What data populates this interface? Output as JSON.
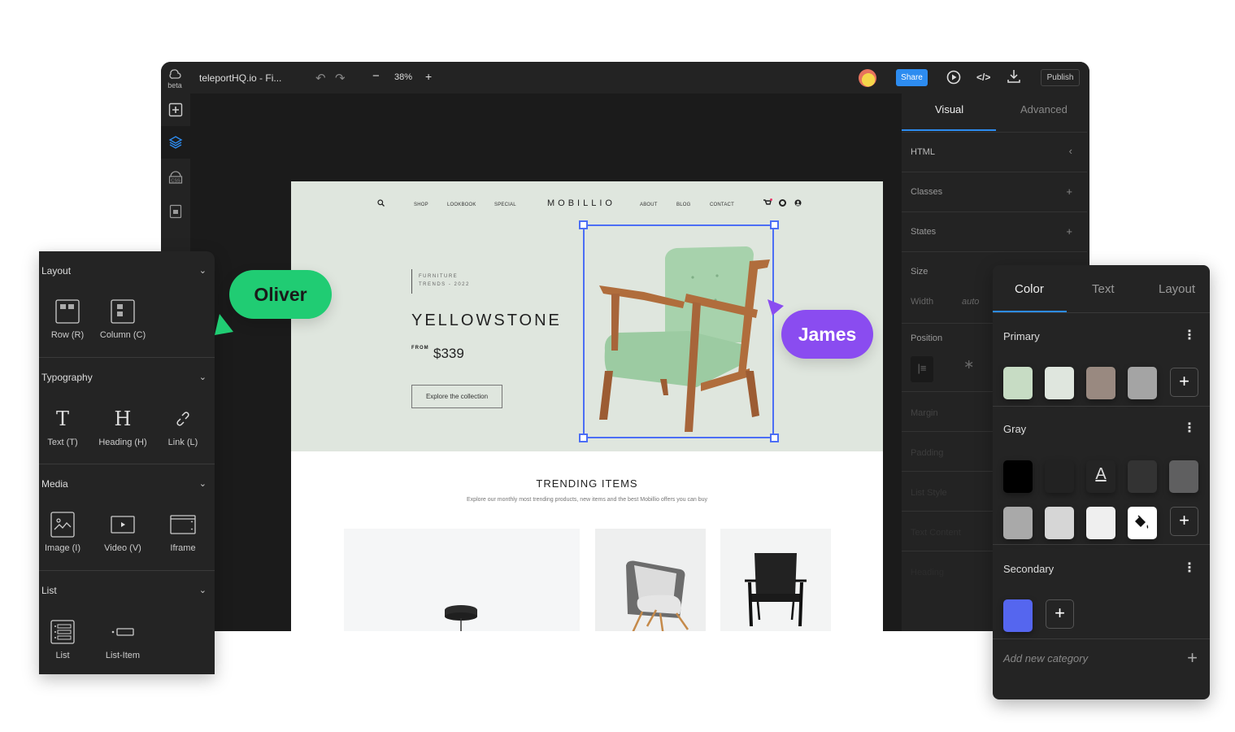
{
  "window": {
    "logo_sub": "beta",
    "title": "teleportHQ.io - Fi...",
    "zoom_level": "38%",
    "share_label": "Share",
    "publish_label": "Publish"
  },
  "site": {
    "nav_left": [
      "SHOP",
      "LOOKBOOK",
      "SPECIAL"
    ],
    "brand": "MOBILLIO",
    "nav_right": [
      "ABOUT",
      "BLOG",
      "CONTACT"
    ],
    "eyebrow_line1": "FURNITURE",
    "eyebrow_line2": "TRENDS - 2022",
    "hero_title": "YELLOWSTONE",
    "hero_from": "FROM",
    "hero_price": "$339",
    "hero_button": "Explore the collection",
    "trending_title": "TRENDING ITEMS",
    "trending_subtitle": "Explore our monthly most trending products, new items and the best Mobillio offers you can buy",
    "products": [
      "pendant-lamp",
      "grey-armchair",
      "black-lounge-chair"
    ]
  },
  "props_panel": {
    "tabs": [
      "Visual",
      "Advanced"
    ],
    "active_tab": "Visual",
    "sections": [
      {
        "label": "HTML",
        "icon": "chevron-left"
      },
      {
        "label": "Classes",
        "icon": "plus"
      },
      {
        "label": "States",
        "icon": "plus"
      }
    ],
    "size_label": "Size",
    "width_label": "Width",
    "width_value": "auto",
    "position_label": "Position",
    "faded_sections": [
      "Margin",
      "Padding",
      "List Style",
      "Text Content",
      "Heading"
    ]
  },
  "elements_panel": {
    "groups": [
      {
        "title": "Layout",
        "items": [
          {
            "label": "Row (R)",
            "icon": "row-icon"
          },
          {
            "label": "Column (C)",
            "icon": "column-icon"
          }
        ]
      },
      {
        "title": "Typography",
        "items": [
          {
            "label": "Text (T)",
            "icon": "text-icon"
          },
          {
            "label": "Heading (H)",
            "icon": "heading-icon"
          },
          {
            "label": "Link (L)",
            "icon": "link-icon"
          }
        ]
      },
      {
        "title": "Media",
        "items": [
          {
            "label": "Image (I)",
            "icon": "image-icon"
          },
          {
            "label": "Video (V)",
            "icon": "video-icon"
          },
          {
            "label": "Iframe",
            "icon": "iframe-icon"
          }
        ]
      },
      {
        "title": "List",
        "items": [
          {
            "label": "List",
            "icon": "list-icon"
          },
          {
            "label": "List-Item",
            "icon": "list-item-icon"
          }
        ]
      }
    ]
  },
  "color_panel": {
    "tabs": [
      "Color",
      "Text",
      "Layout"
    ],
    "active_tab": "Color",
    "primary": {
      "title": "Primary",
      "swatches": [
        "#c7dcc4",
        "#dfe6de",
        "#998980",
        "#a4a4a4"
      ]
    },
    "gray": {
      "title": "Gray",
      "swatches_row1": [
        "#000000",
        "#222222",
        "text-color",
        "#333333",
        "#5f5f60"
      ],
      "swatches_row2": [
        "#a9a9a9",
        "#d6d6d6",
        "#efefef",
        "fill-color"
      ]
    },
    "secondary": {
      "title": "Secondary",
      "swatches": [
        "#5566ef"
      ]
    },
    "add_category": "Add new category"
  },
  "collaborators": [
    {
      "name": "Oliver",
      "color": "#20cc73"
    },
    {
      "name": "James",
      "color": "#8a4cf0"
    }
  ],
  "colors": {
    "accent": "#2d8cf0",
    "selection": "#4c6ef5"
  }
}
